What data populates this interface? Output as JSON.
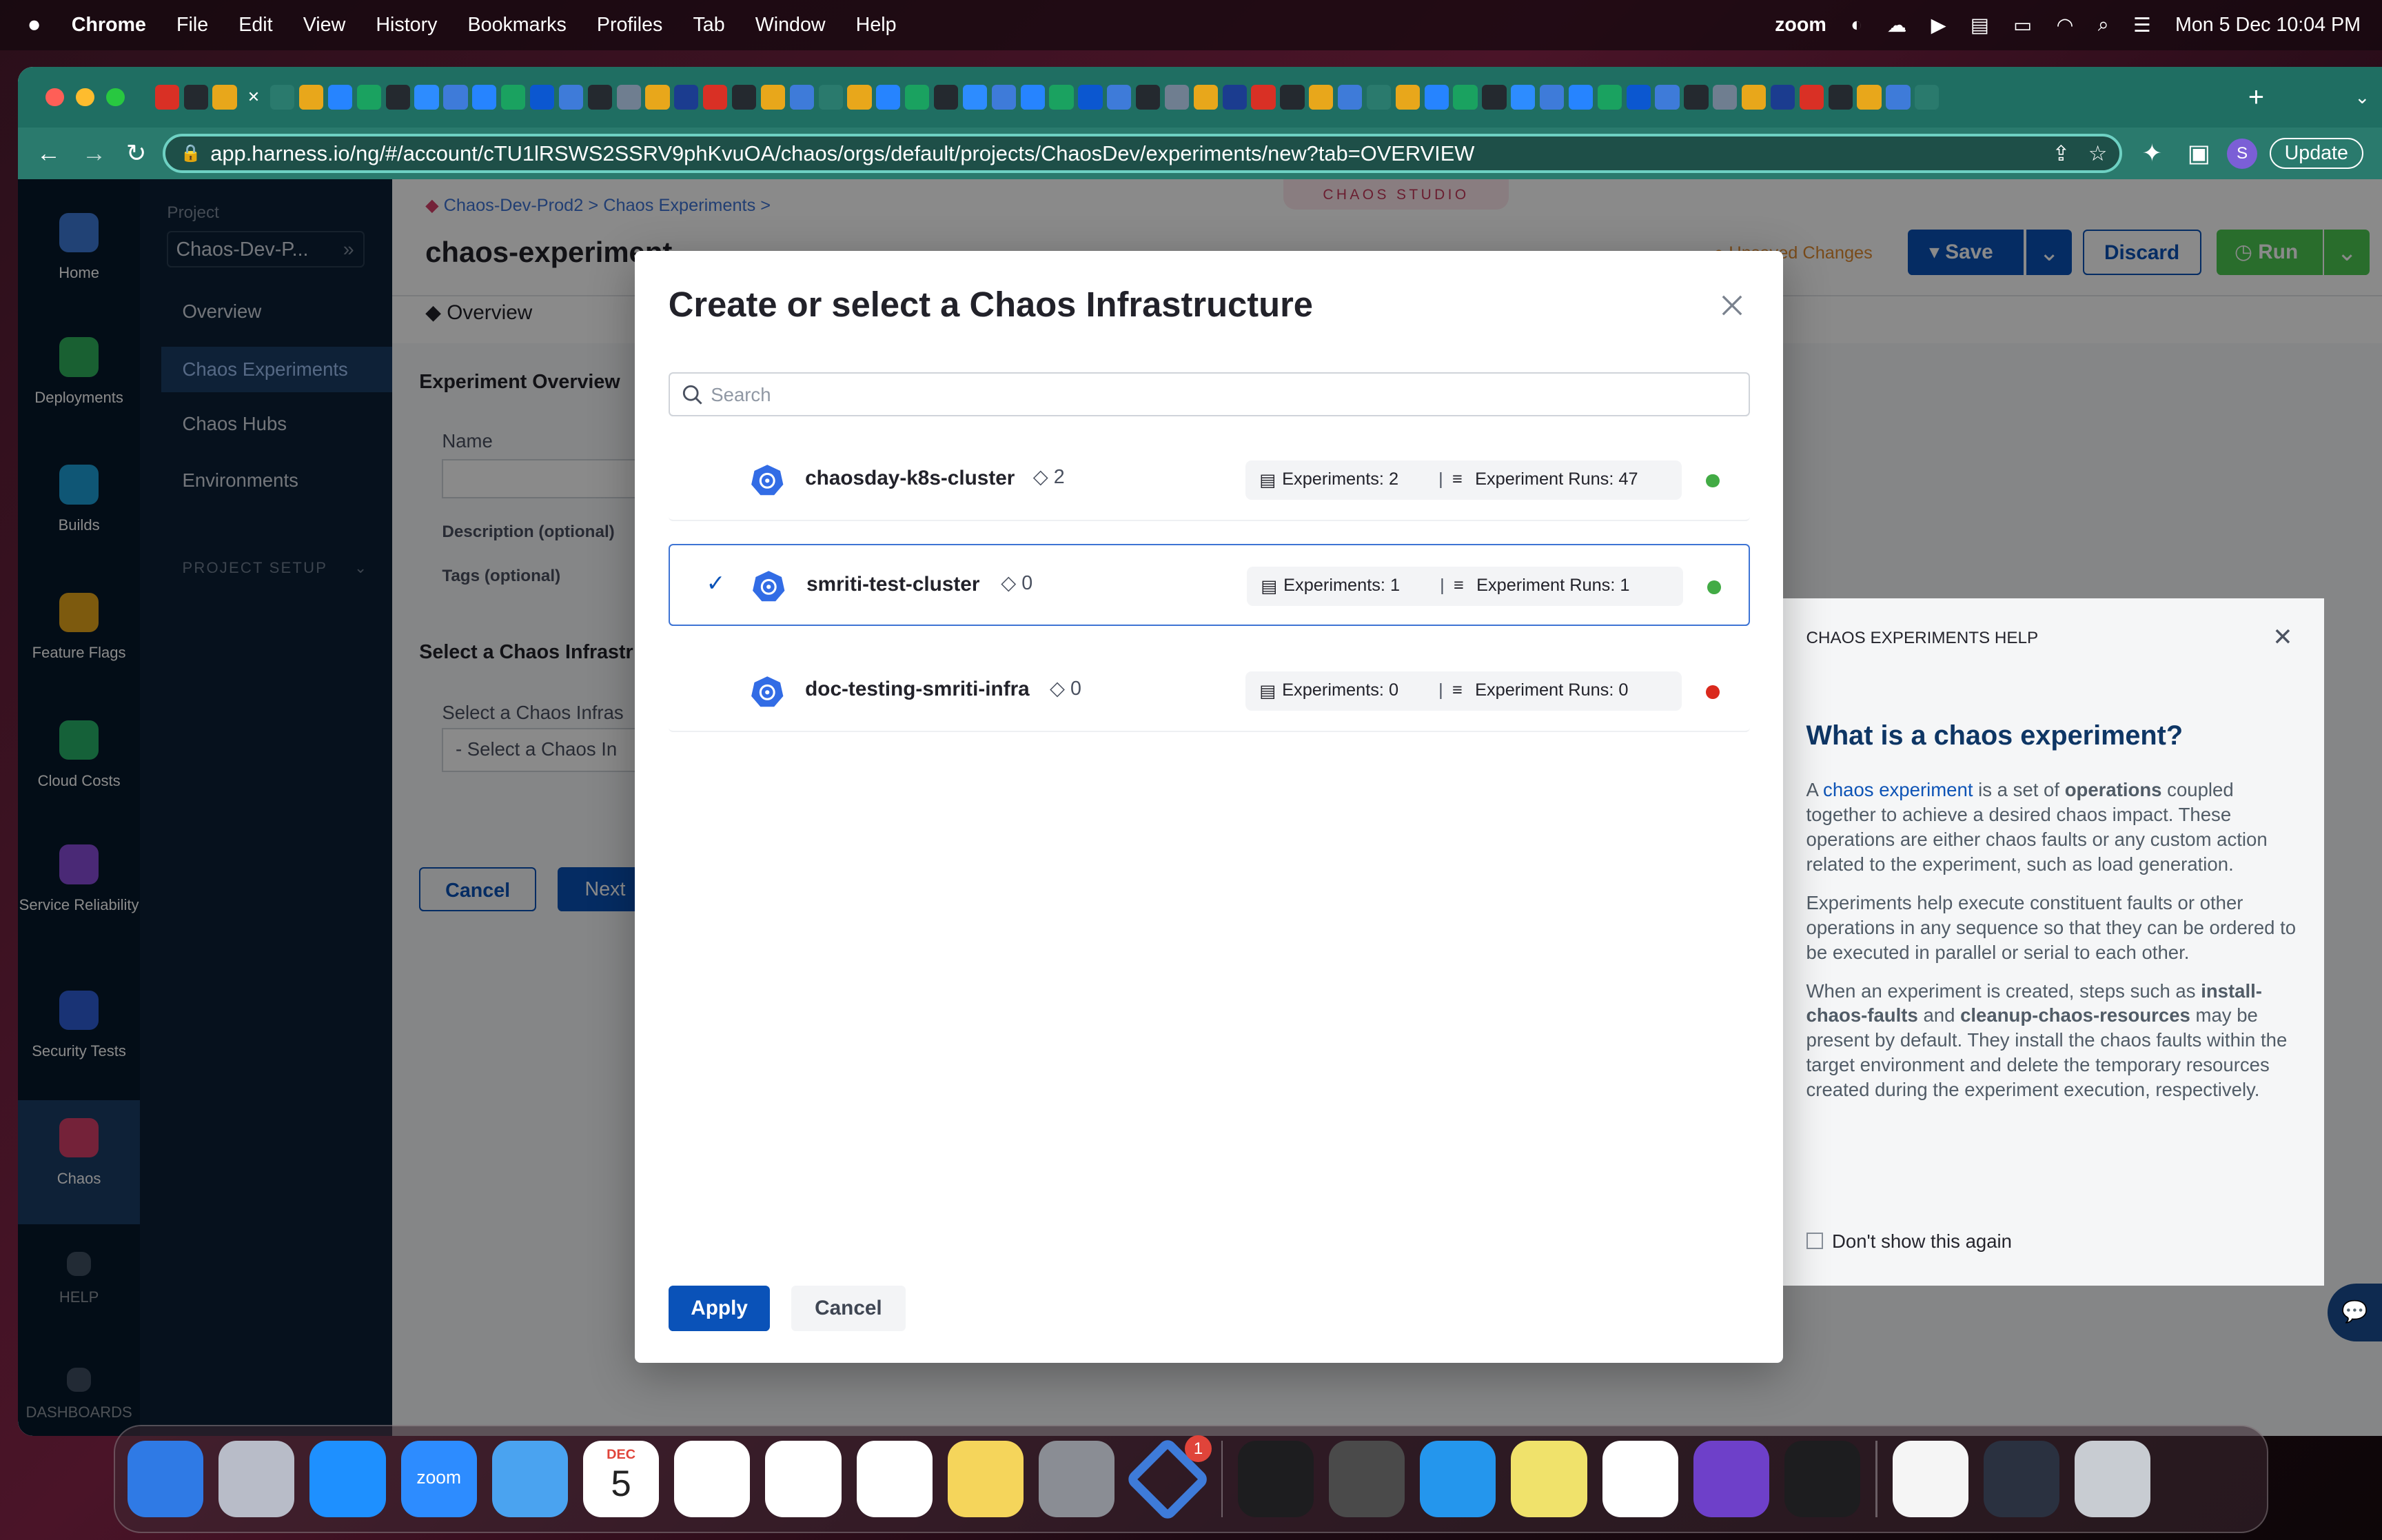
{
  "menubar": {
    "app": "Chrome",
    "items": [
      "File",
      "Edit",
      "View",
      "History",
      "Bookmarks",
      "Profiles",
      "Tab",
      "Window",
      "Help"
    ],
    "zoom": "zoom",
    "datetime": "Mon 5 Dec  10:04 PM"
  },
  "browser": {
    "url": "app.harness.io/ng/#/account/cTU1lRSWS2SSRV9phKvuOA/chaos/orgs/default/projects/ChaosDev/experiments/new?tab=OVERVIEW",
    "update_label": "Update",
    "profile_initial": "S",
    "tab_close": "✕"
  },
  "leftnav": {
    "items": [
      {
        "label": "Home",
        "color": "#3e7bd9"
      },
      {
        "label": "Deployments",
        "color": "#2fb25d"
      },
      {
        "label": "Builds",
        "color": "#1da0d9"
      },
      {
        "label": "Feature Flags",
        "color": "#e8a71b"
      },
      {
        "label": "Cloud Costs",
        "color": "#28b46a"
      },
      {
        "label": "Service Reliability",
        "color": "#8a4ddb"
      },
      {
        "label": "Security Tests",
        "color": "#2f5fd9"
      },
      {
        "label": "Chaos",
        "color": "#d6406a"
      }
    ],
    "help": "HELP",
    "dashboards": "DASHBOARDS"
  },
  "project_panel": {
    "project_label": "Project",
    "project_name": "Chaos-Dev-P...",
    "items": [
      "Overview",
      "Chaos Experiments",
      "Chaos Hubs",
      "Environments"
    ],
    "section": "PROJECT SETUP"
  },
  "page": {
    "breadcrumb": [
      "Chaos-Dev-Prod2",
      "Chaos Experiments"
    ],
    "chaos_studio": "CHAOS STUDIO",
    "title": "chaos-experiment",
    "unsaved": "Unsaved Changes",
    "save": "Save",
    "discard": "Discard",
    "run": "Run",
    "tab_overview": "Overview",
    "section_overview": "Experiment Overview",
    "name_label": "Name",
    "desc_label": "Description (optional)",
    "tags_label": "Tags (optional)",
    "infra_section": "Select a Chaos Infrastr",
    "infra_label": "Select a Chaos Infras",
    "infra_placeholder": "- Select a Chaos In",
    "cancel": "Cancel",
    "next": "Next"
  },
  "modal": {
    "title": "Create or select a Chaos Infrastructure",
    "search_placeholder": "Search",
    "rows": [
      {
        "name": "chaosday-k8s-cluster",
        "tags": "2",
        "experiments": "Experiments: 2",
        "runs": "Experiment Runs: 47",
        "status_color": "#42ab45",
        "selected": false
      },
      {
        "name": "smriti-test-cluster",
        "tags": "0",
        "experiments": "Experiments: 1",
        "runs": "Experiment Runs: 1",
        "status_color": "#42ab45",
        "selected": true
      },
      {
        "name": "doc-testing-smriti-infra",
        "tags": "0",
        "experiments": "Experiments: 0",
        "runs": "Experiment Runs: 0",
        "status_color": "#da291d",
        "selected": false
      }
    ],
    "apply": "Apply",
    "cancel": "Cancel"
  },
  "help_panel": {
    "header": "CHAOS EXPERIMENTS HELP",
    "title": "What is a chaos experiment?",
    "p1_a": "A ",
    "p1_link": "chaos experiment",
    "p1_b": " is a set of ",
    "p1_bold": "operations",
    "p1_c": " coupled together to achieve a desired chaos impact. These operations are either chaos faults or any custom action related to the experiment, such as load generation.",
    "p2": "Experiments help execute constituent faults or other operations in any sequence so that they can be ordered to be executed in parallel or serial to each other.",
    "p3_a": "When an experiment is created, steps such as ",
    "p3_b1": "install-chaos-faults",
    "p3_c": " and ",
    "p3_b2": "cleanup-chaos-resources",
    "p3_d": " may be present by default. They install the chaos faults within the target environment and delete the temporary resources created during the experiment execution, respectively.",
    "checkbox": "Don't show this again"
  },
  "dock": {
    "calendar_month": "DEC",
    "calendar_day": "5",
    "zoom_label": "zoom",
    "harness_badge": "1"
  }
}
